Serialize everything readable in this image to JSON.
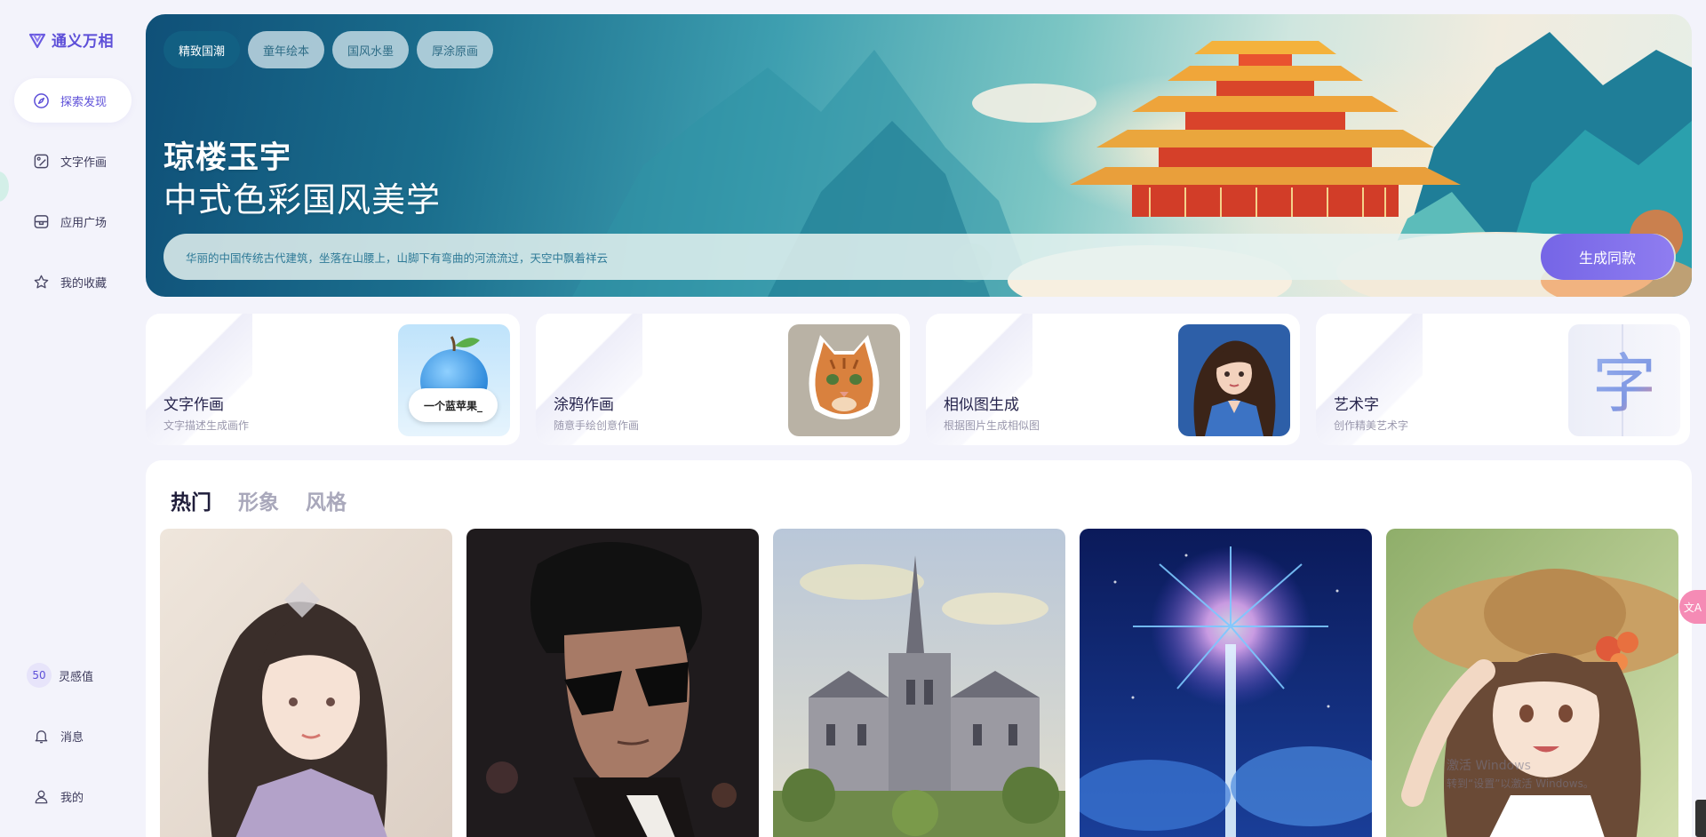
{
  "app": {
    "name": "通义万相"
  },
  "sidebar": {
    "items": [
      {
        "label": "探索发现",
        "icon": "compass-icon",
        "active": true
      },
      {
        "label": "文字作画",
        "icon": "image-edit-icon",
        "active": false
      },
      {
        "label": "应用广场",
        "icon": "app-box-icon",
        "active": false
      },
      {
        "label": "我的收藏",
        "icon": "star-icon",
        "active": false
      }
    ],
    "bottom": {
      "points_value": "50",
      "points_label": "灵感值",
      "messages_label": "消息",
      "profile_label": "我的"
    }
  },
  "banner": {
    "chips": [
      {
        "label": "精致国潮",
        "active": true
      },
      {
        "label": "童年绘本",
        "active": false
      },
      {
        "label": "国风水墨",
        "active": false
      },
      {
        "label": "厚涂原画",
        "active": false
      }
    ],
    "title": "琼楼玉宇",
    "subtitle": "中式色彩国风美学",
    "prompt": "华丽的中国传统古代建筑，坐落在山腰上，山脚下有弯曲的河流流过，天空中飘着祥云",
    "generate_label": "生成同款"
  },
  "feature_cards": [
    {
      "title": "文字作画",
      "desc": "文字描述生成画作",
      "thumb_label": "一个蓝苹果_",
      "thumb": "blue-apple-thumbnail"
    },
    {
      "title": "涂鸦作画",
      "desc": "随意手绘创意作画",
      "thumb": "cat-sticker-thumbnail"
    },
    {
      "title": "相似图生成",
      "desc": "根据图片生成相似图",
      "thumb": "anime-girl-thumbnail"
    },
    {
      "title": "艺术字",
      "desc": "创作精美艺术字",
      "thumb_label": "字",
      "thumb": "art-text-thumbnail"
    }
  ],
  "gallery": {
    "tabs": [
      {
        "label": "热门",
        "active": true
      },
      {
        "label": "形象",
        "active": false
      },
      {
        "label": "风格",
        "active": false
      }
    ],
    "tiles": [
      {
        "subject": "ancient-chinese-woman-portrait"
      },
      {
        "subject": "man-with-sunglasses-illustration"
      },
      {
        "subject": "cathedral-oil-painting"
      },
      {
        "subject": "fireworks-night-sky"
      },
      {
        "subject": "girl-in-straw-hat"
      }
    ]
  },
  "overlay": {
    "translate_label": "文A",
    "watermark_line1": "激活 Windows",
    "watermark_line2": "转到“设置”以激活 Windows。"
  },
  "colors": {
    "accent": "#5d4fd8",
    "button": "#7d6ce8",
    "background": "#f3f3fb"
  }
}
